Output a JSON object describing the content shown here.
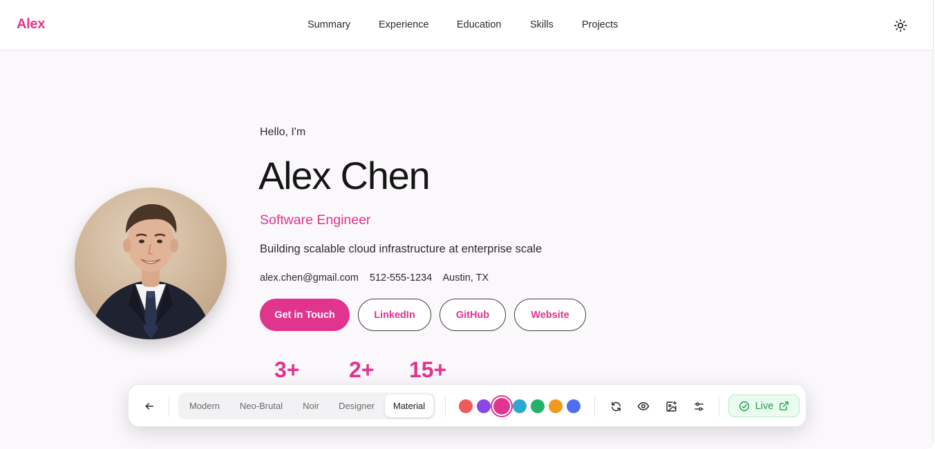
{
  "header": {
    "brand": "Alex",
    "nav": [
      "Summary",
      "Experience",
      "Education",
      "Skills",
      "Projects"
    ],
    "theme_toggle_icon": "sun-icon"
  },
  "hero": {
    "greeting": "Hello, I'm",
    "name": "Alex Chen",
    "role": "Software Engineer",
    "tagline": "Building scalable cloud infrastructure at enterprise scale",
    "contacts": {
      "email": "alex.chen@gmail.com",
      "phone": "512-555-1234",
      "location": "Austin, TX"
    },
    "buttons": {
      "primary": "Get in Touch",
      "linkedin": "LinkedIn",
      "github": "GitHub",
      "website": "Website"
    },
    "stats": [
      "3+",
      "2+",
      "15+"
    ]
  },
  "toolbar": {
    "back_icon": "arrow-left-icon",
    "themes": [
      "Modern",
      "Neo-Brutal",
      "Noir",
      "Designer",
      "Material"
    ],
    "active_theme": "Material",
    "swatches": [
      "#ef5a5a",
      "#8b45e8",
      "#e0348f",
      "#2ba9cf",
      "#22b36b",
      "#ef9a1f",
      "#4f6ff0"
    ],
    "selected_swatch": "#e0348f",
    "tools": [
      "refresh-icon",
      "eye-icon",
      "image-sparkle-icon",
      "sliders-icon"
    ],
    "live_label": "Live",
    "accent": "#e0348f",
    "live_color": "#1f9d4d"
  }
}
